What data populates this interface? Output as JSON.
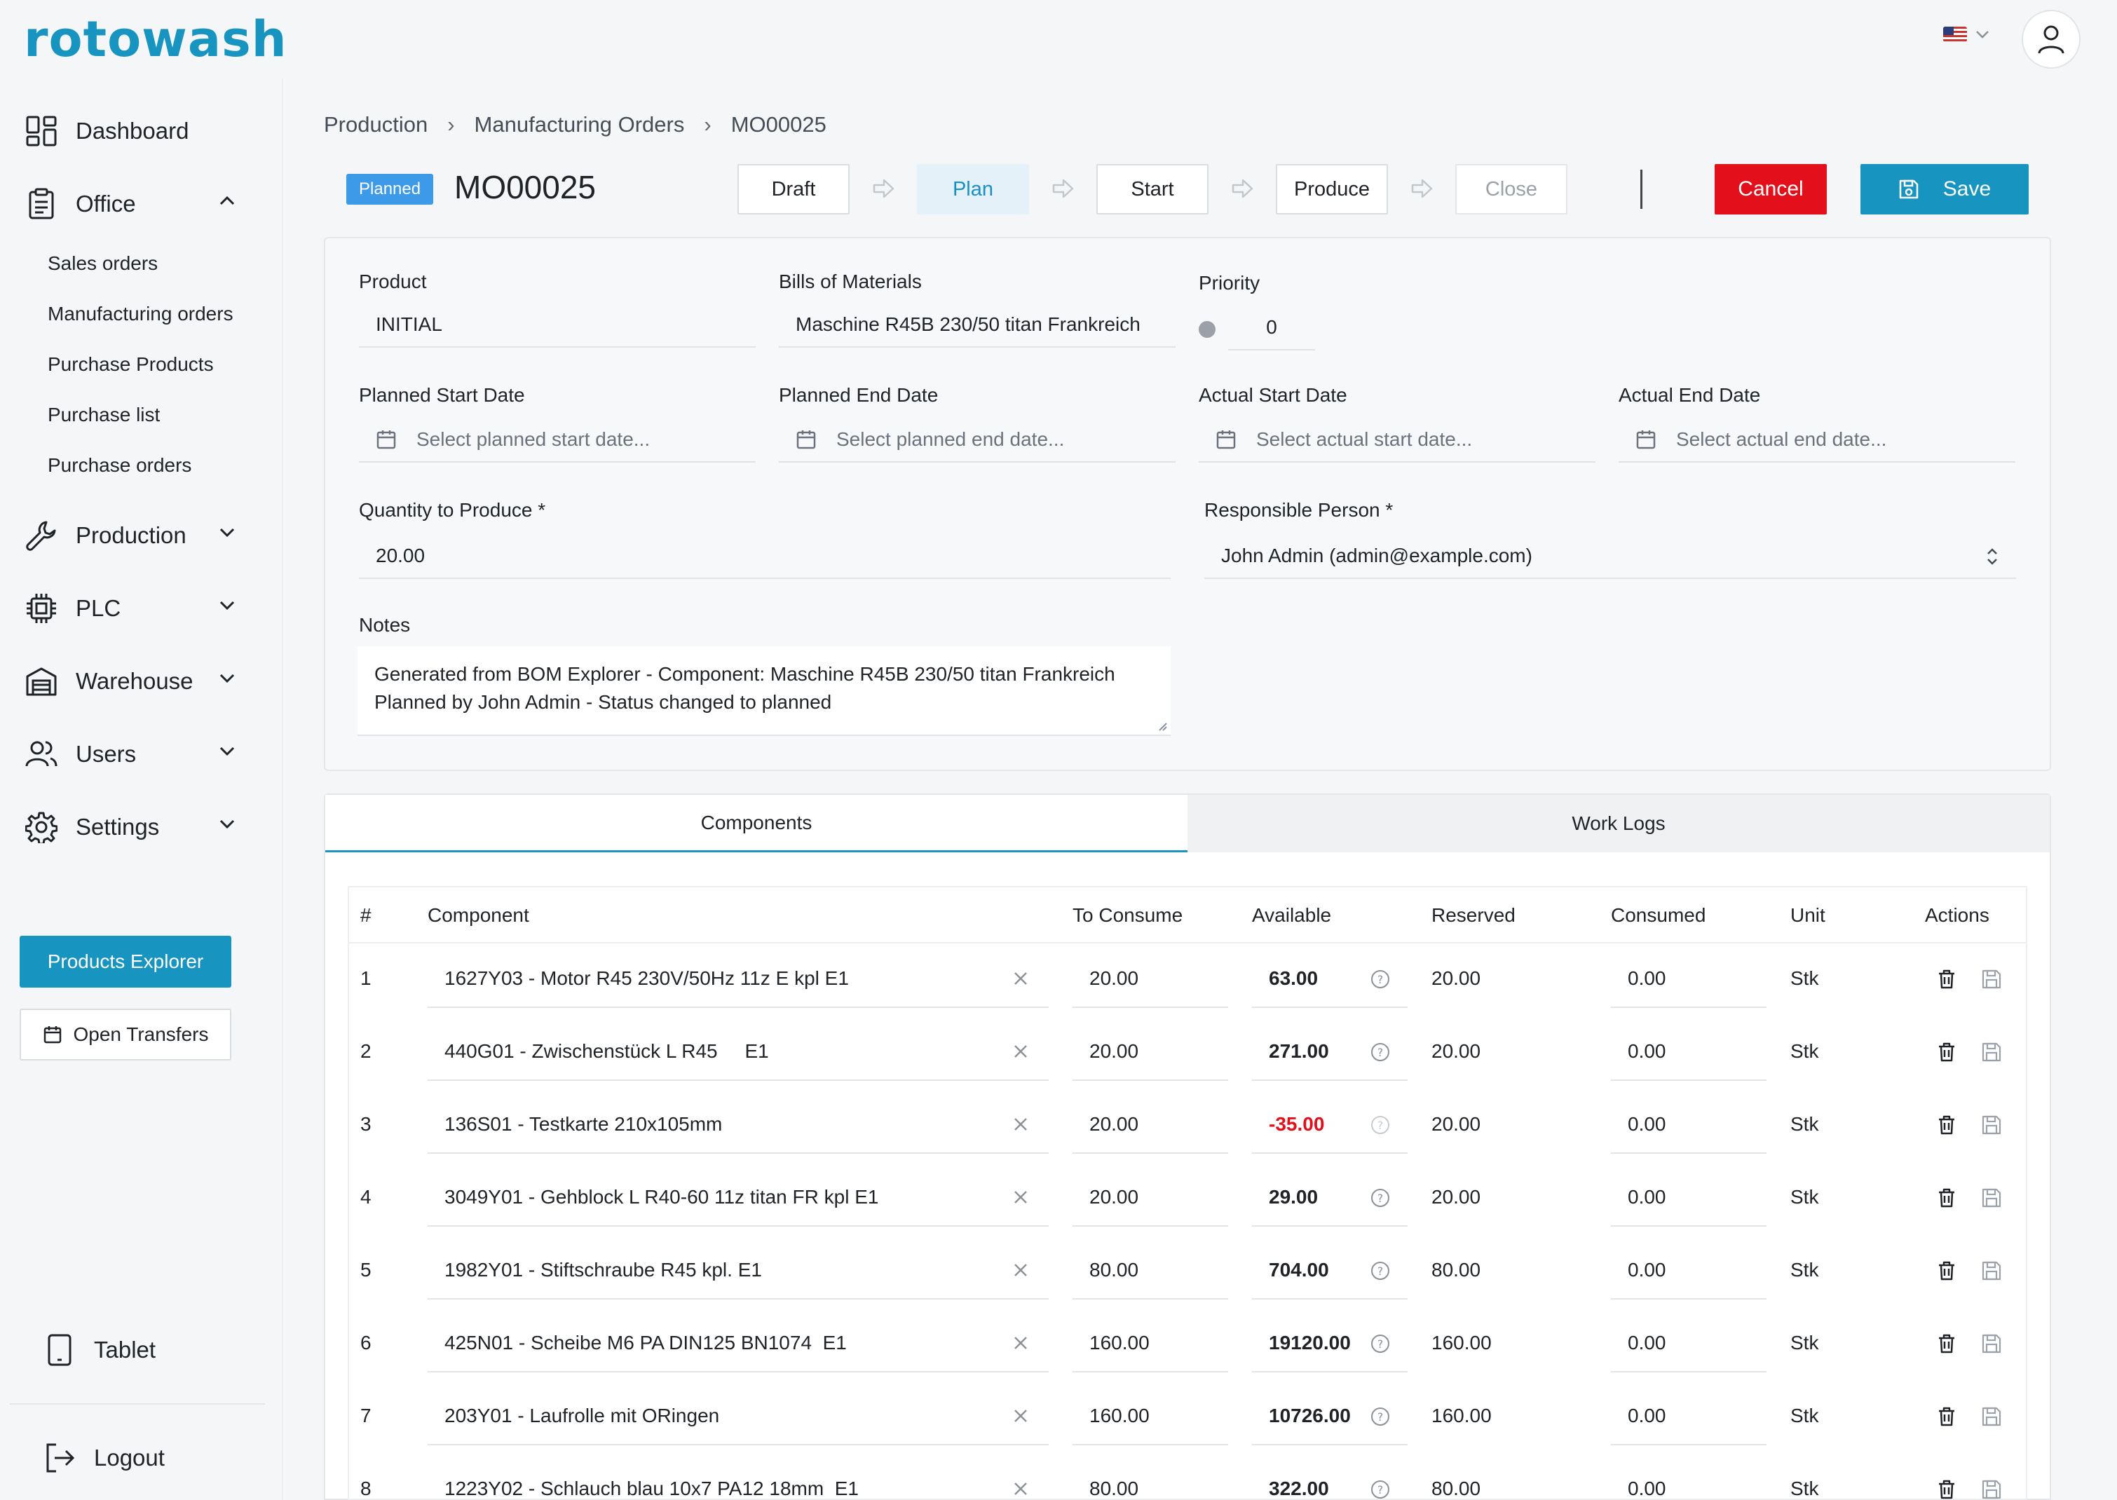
{
  "app": {
    "logo": "rotowash"
  },
  "sidebar": {
    "dashboard": "Dashboard",
    "office": "Office",
    "office_items": [
      "Sales orders",
      "Manufacturing orders",
      "Purchase Products",
      "Purchase list",
      "Purchase orders"
    ],
    "production": "Production",
    "plc": "PLC",
    "warehouse": "Warehouse",
    "users": "Users",
    "settings": "Settings",
    "products_explorer": "Products Explorer",
    "open_transfers": "Open Transfers",
    "tablet": "Tablet",
    "logout": "Logout"
  },
  "breadcrumb": [
    "Production",
    "Manufacturing Orders",
    "MO00025"
  ],
  "header": {
    "status": "Planned",
    "title": "MO00025",
    "steps": [
      "Draft",
      "Plan",
      "Start",
      "Produce",
      "Close"
    ],
    "active_step": "Plan",
    "cancel": "Cancel",
    "save": "Save"
  },
  "form": {
    "product_label": "Product",
    "product_value": "INITIAL",
    "bom_label": "Bills of Materials",
    "bom_value": "Maschine R45B 230/50 titan Frankreich",
    "priority_label": "Priority",
    "priority_value": "0",
    "planned_start_label": "Planned Start Date",
    "planned_start_placeholder": "Select planned start date...",
    "planned_end_label": "Planned End Date",
    "planned_end_placeholder": "Select planned end date...",
    "actual_start_label": "Actual Start Date",
    "actual_start_placeholder": "Select actual start date...",
    "actual_end_label": "Actual End Date",
    "actual_end_placeholder": "Select actual end date...",
    "quantity_label": "Quantity to Produce *",
    "quantity_value": "20.00",
    "responsible_label": "Responsible Person *",
    "responsible_value": "John Admin (admin@example.com)",
    "notes_label": "Notes",
    "notes_line1": "Generated from BOM Explorer - Component: Maschine R45B 230/50 titan Frankreich",
    "notes_line2": "Planned by John Admin - Status changed to planned"
  },
  "tabs": [
    "Components",
    "Work Logs"
  ],
  "table": {
    "headers": [
      "#",
      "Component",
      "To Consume",
      "Available",
      "Reserved",
      "Consumed",
      "Unit",
      "Actions"
    ],
    "rows": [
      {
        "n": "1",
        "component": "1627Y03 - Motor R45 230V/50Hz 11z E kpl E1",
        "to_consume": "20.00",
        "available": "63.00",
        "reserved": "20.00",
        "consumed": "0.00",
        "unit": "Stk",
        "negative": false
      },
      {
        "n": "2",
        "component": "440G01 - Zwischenstück L R45     E1",
        "to_consume": "20.00",
        "available": "271.00",
        "reserved": "20.00",
        "consumed": "0.00",
        "unit": "Stk",
        "negative": false
      },
      {
        "n": "3",
        "component": "136S01 - Testkarte 210x105mm",
        "to_consume": "20.00",
        "available": "-35.00",
        "reserved": "20.00",
        "consumed": "0.00",
        "unit": "Stk",
        "negative": true
      },
      {
        "n": "4",
        "component": "3049Y01 - Gehblock L R40-60 11z titan FR kpl E1",
        "to_consume": "20.00",
        "available": "29.00",
        "reserved": "20.00",
        "consumed": "0.00",
        "unit": "Stk",
        "negative": false
      },
      {
        "n": "5",
        "component": "1982Y01 - Stiftschraube R45 kpl. E1",
        "to_consume": "80.00",
        "available": "704.00",
        "reserved": "80.00",
        "consumed": "0.00",
        "unit": "Stk",
        "negative": false
      },
      {
        "n": "6",
        "component": "425N01 - Scheibe M6 PA DIN125 BN1074  E1",
        "to_consume": "160.00",
        "available": "19120.00",
        "reserved": "160.00",
        "consumed": "0.00",
        "unit": "Stk",
        "negative": false
      },
      {
        "n": "7",
        "component": "203Y01 - Laufrolle mit ORingen",
        "to_consume": "160.00",
        "available": "10726.00",
        "reserved": "160.00",
        "consumed": "0.00",
        "unit": "Stk",
        "negative": false
      },
      {
        "n": "8",
        "component": "1223Y02 - Schlauch blau 10x7 PA12 18mm  E1",
        "to_consume": "80.00",
        "available": "322.00",
        "reserved": "80.00",
        "consumed": "0.00",
        "unit": "Stk",
        "negative": false
      }
    ]
  },
  "colors": {
    "brand": "#1795c0",
    "danger": "#e3101b",
    "badge": "#3d9ae8"
  }
}
